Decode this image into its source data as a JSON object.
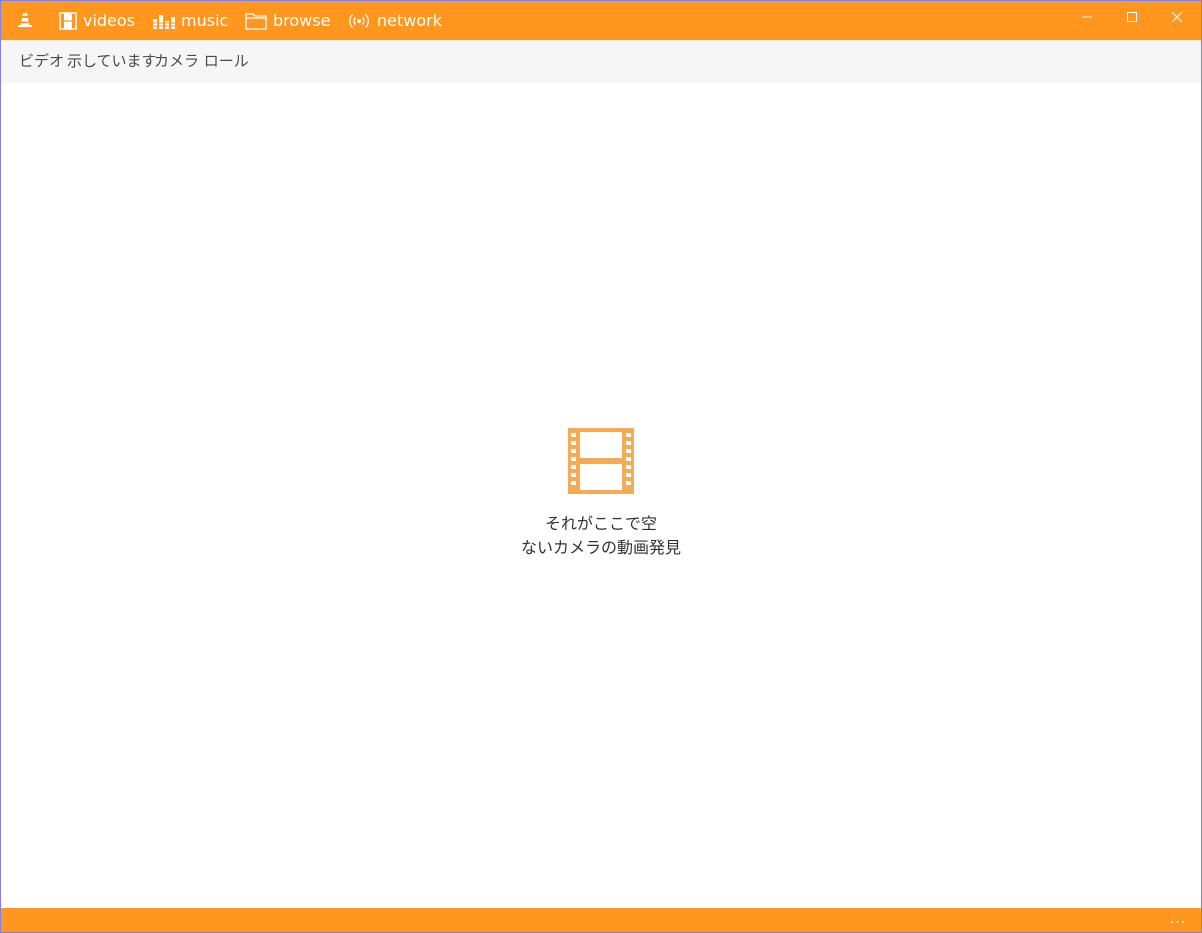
{
  "titlebar": {
    "nav": [
      {
        "label": "videos",
        "icon": "film-icon"
      },
      {
        "label": "music",
        "icon": "equalizer-icon"
      },
      {
        "label": "browse",
        "icon": "folder-icon"
      },
      {
        "label": "network",
        "icon": "broadcast-icon"
      }
    ],
    "window_controls": {
      "minimize": "—",
      "maximize": "☐",
      "close": "✕"
    }
  },
  "toolbar": {
    "filters": [
      {
        "label": "ビデオ"
      },
      {
        "label": "示しています"
      },
      {
        "label": "カメラ ロール"
      }
    ]
  },
  "empty_state": {
    "icon": "film-strip-icon",
    "line1": "それがここで空",
    "line2": "ないカメラの動画発見"
  },
  "bottombar": {
    "more_label": "..."
  },
  "colors": {
    "accent": "#ff961e",
    "icon_orange": "#f5aa55",
    "toolbar_bg": "#f6f6f6"
  }
}
